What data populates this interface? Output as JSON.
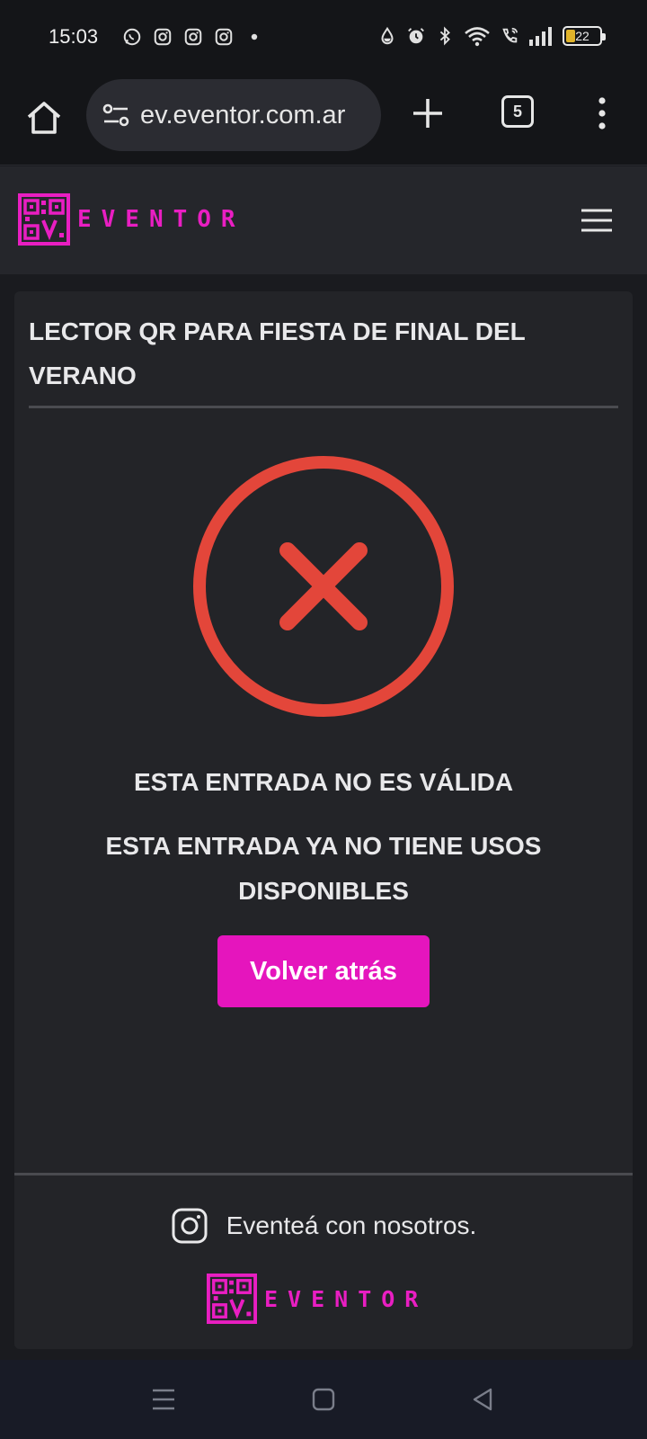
{
  "status_bar": {
    "time": "15:03",
    "left_icons": [
      "whatsapp-icon",
      "instagram-icon",
      "instagram-icon",
      "instagram-icon",
      "dot-icon"
    ],
    "right_icons": [
      "water-drop-icon",
      "alarm-icon",
      "bluetooth-icon",
      "wifi-icon",
      "wifi-call-icon",
      "signal-icon"
    ],
    "battery_level": "22"
  },
  "browser": {
    "url": "ev.eventor.com.ar",
    "tab_count": "5"
  },
  "site": {
    "logo_text": "EVENTOR",
    "brand_color": "#e515bd"
  },
  "card": {
    "title": "LECTOR QR PARA FIESTA DE FINAL DEL VERANO",
    "message_primary": "ESTA ENTRADA NO ES VÁLIDA",
    "message_secondary": "ESTA ENTRADA YA NO TIENE USOS DISPONIBLES",
    "back_button_label": "Volver atrás",
    "error_color": "#e3463a"
  },
  "footer": {
    "social_text": "Eventeá con nosotros.",
    "logo_text": "EVENTOR"
  }
}
